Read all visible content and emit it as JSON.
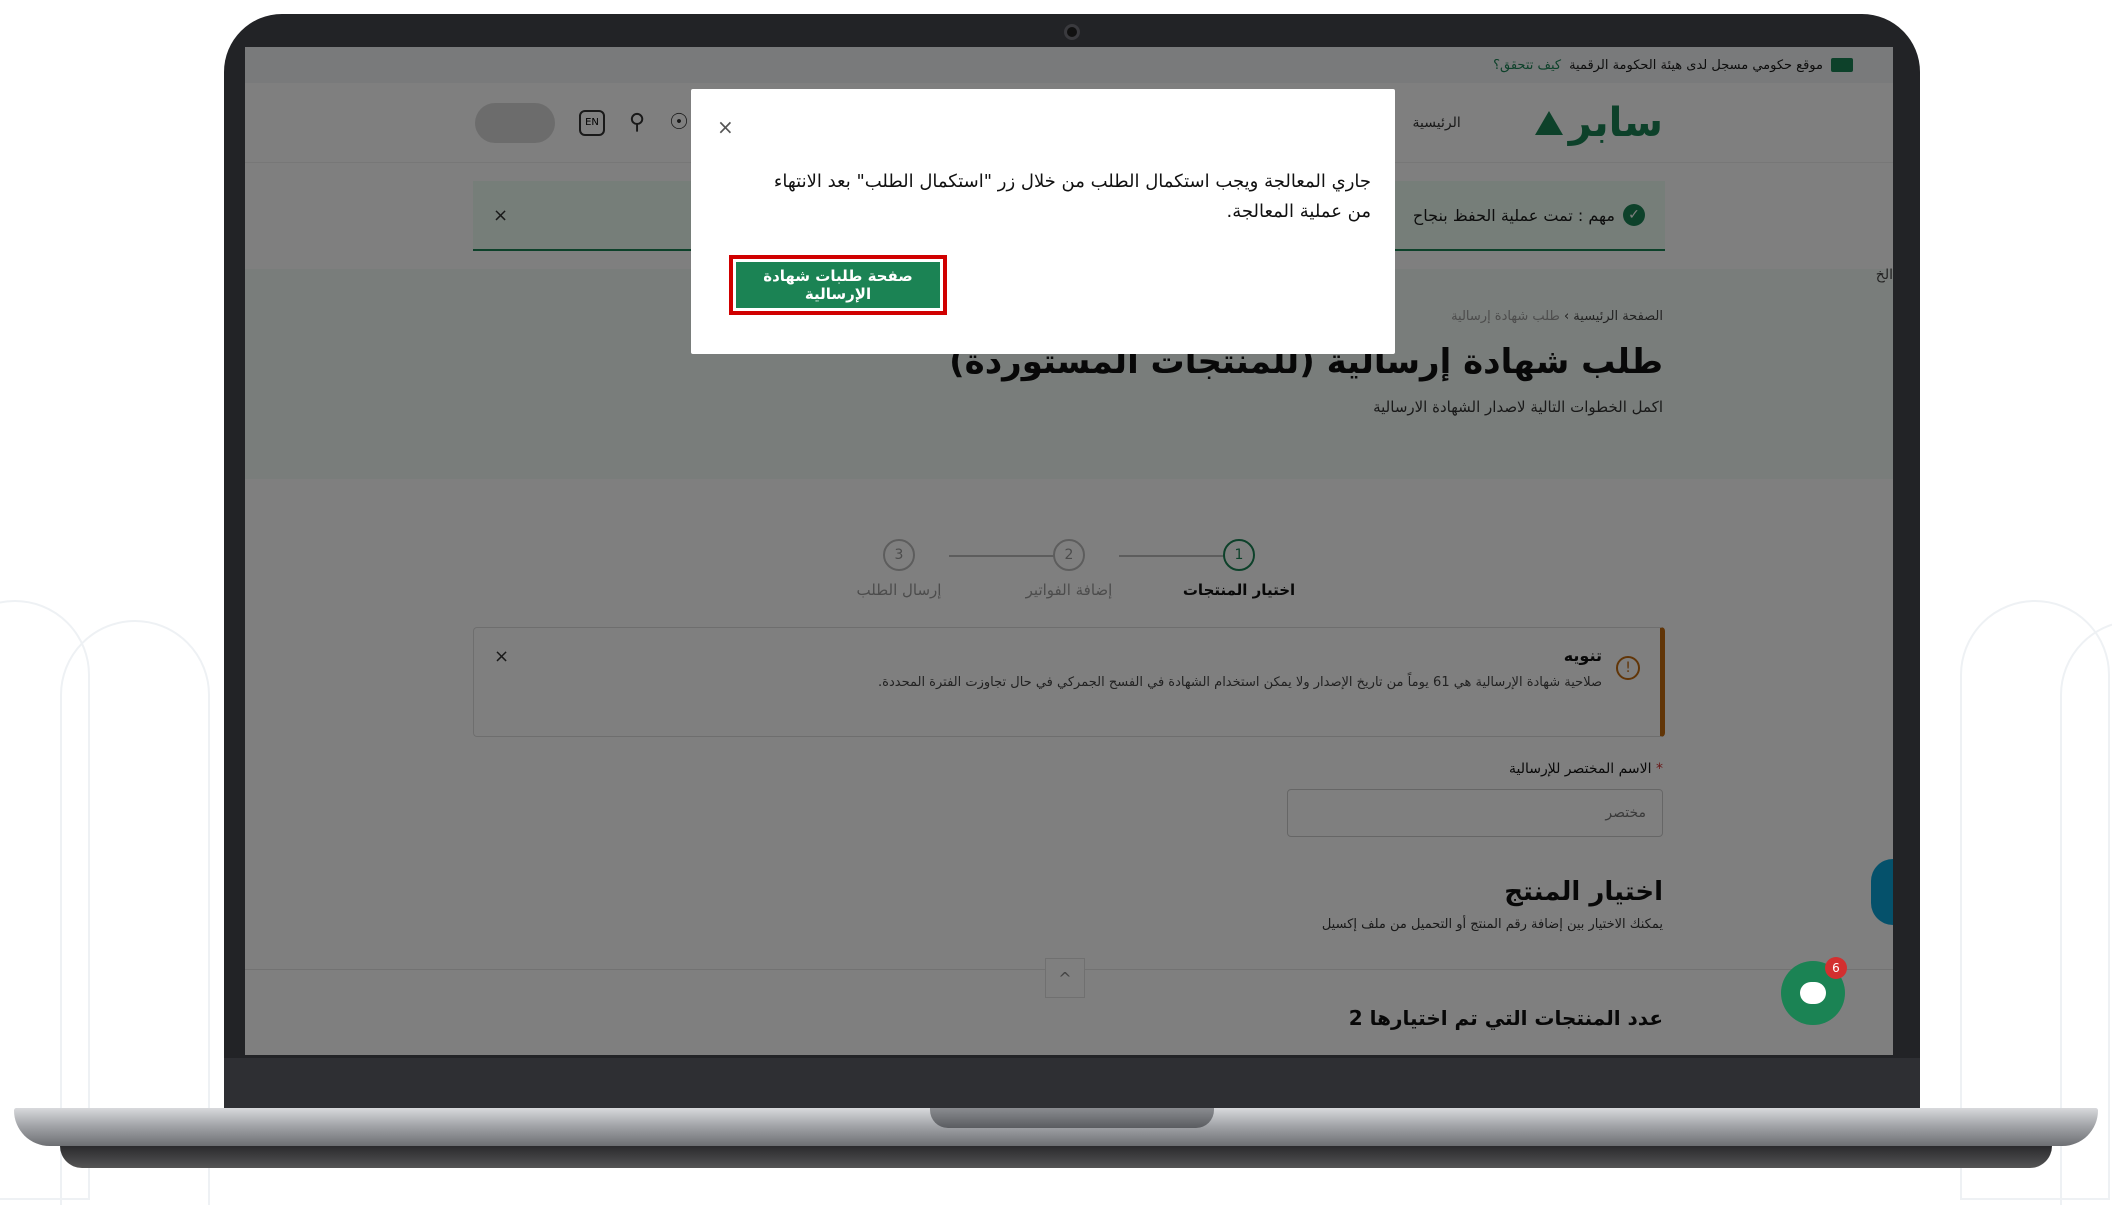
{
  "topbar": {
    "gov_text": "موقع حكومي مسجل لدى هيئة الحكومة الرقمية",
    "verify_link": "كيف تتحقق؟"
  },
  "header": {
    "logo_text": "سابر",
    "nav_home": "الرئيسية",
    "lang_label": "EN"
  },
  "success": {
    "text": "مهم : تمت عملية الحفظ بنجاح",
    "close": "×"
  },
  "hero": {
    "breadcrumb_home": "الصفحة الرئيسية",
    "breadcrumb_sep": "›",
    "breadcrumb_current": "طلب شهادة إرسالية",
    "title": "طلب شهادة إرسالية (للمنتجات المستوردة)",
    "subtitle": "اكمل الخطوات التالية لاصدار الشهادة الارسالية"
  },
  "stepper": {
    "steps": [
      {
        "num": "1",
        "label": "اختيار المنتجات",
        "active": true
      },
      {
        "num": "2",
        "label": "إضافة الفواتير",
        "active": false
      },
      {
        "num": "3",
        "label": "إرسال الطلب",
        "active": false
      }
    ]
  },
  "notice": {
    "icon": "!",
    "title": "تنويه",
    "text": "صلاحية شهادة الإرسالية هي 61 يوماً من تاريخ الإصدار ولا يمكن استخدام الشهادة في الفسح الجمركي في حال تجاوزت الفترة المحددة.",
    "close": "×"
  },
  "form": {
    "short_name_label": "الاسم المختصر للإرسالية",
    "required_mark": "*",
    "short_name_placeholder": "مختصر"
  },
  "product_section": {
    "title": "اختيار المنتج",
    "subtitle": "يمكنك الاختيار بين إضافة رقم المنتج أو التحميل من ملف إكسيل"
  },
  "bottom": {
    "count_text": "عدد المنتجات التي تم اختيارها 2",
    "scroll_up": "^"
  },
  "side": {
    "cut_text": "الخ"
  },
  "chat": {
    "badge": "6"
  },
  "modal": {
    "close": "×",
    "message": "جاري المعالجة ويجب استكمال الطلب من خلال زر \"استكمال الطلب\" بعد الانتهاء من عملية المعالجة.",
    "button_label": "صفحة طلبات شهادة الإرسالية"
  },
  "colors": {
    "brand_green": "#1b8354",
    "highlight_red": "#d00000",
    "warning_orange": "#c26a0e"
  }
}
